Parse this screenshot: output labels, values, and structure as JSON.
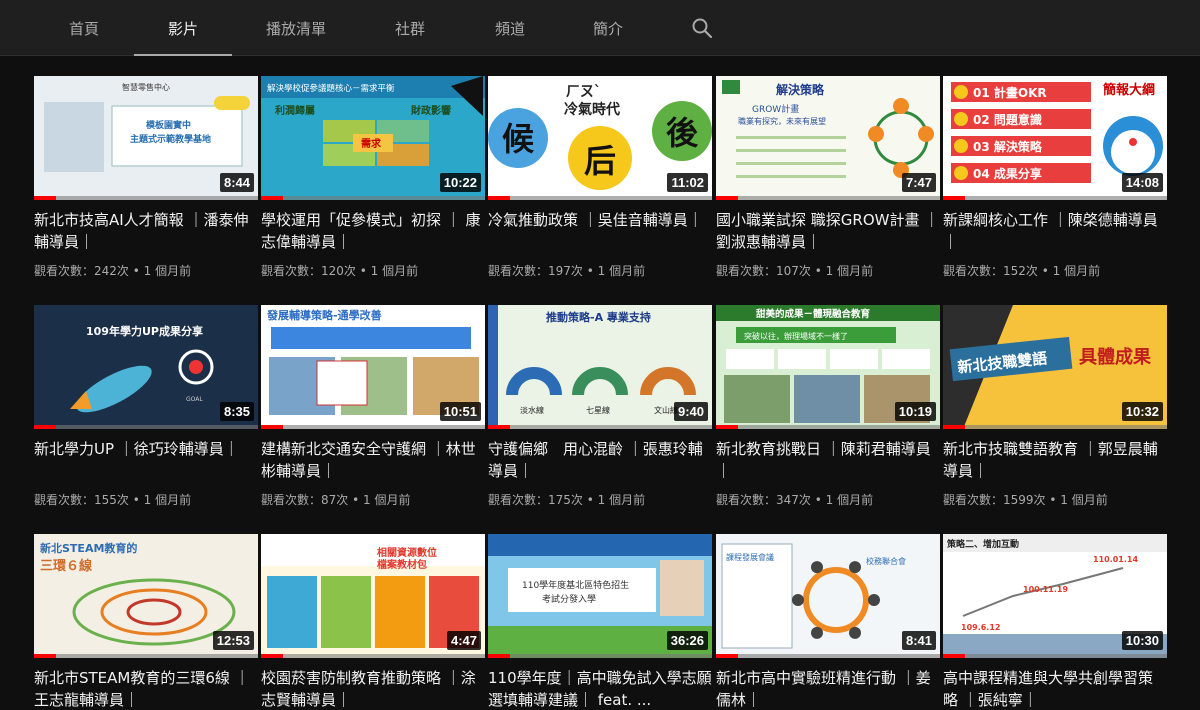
{
  "nav": {
    "tabs": [
      {
        "label": "首頁",
        "active": false
      },
      {
        "label": "影片",
        "active": true
      },
      {
        "label": "播放清單",
        "active": false
      },
      {
        "label": "社群",
        "active": false
      },
      {
        "label": "頻道",
        "active": false
      },
      {
        "label": "簡介",
        "active": false
      }
    ],
    "search_icon": "search-icon"
  },
  "videos": [
    {
      "title": "新北市技高AI人才簡報 ｜潘泰伸輔導員｜",
      "views": "觀看次數：242次",
      "age": "1 個月前",
      "duration": "8:44",
      "progress": 0.1,
      "thumb": {
        "bg": "#e9eef2",
        "text": [
          "智慧零售中心",
          "模板園實中",
          "主題式示範教學基地"
        ],
        "accent": "#2a6fb0"
      }
    },
    {
      "title": "學校運用「促參模式」初探 ｜ 康志偉輔導員｜",
      "views": "觀看次數：120次",
      "age": "1 個月前",
      "duration": "10:22",
      "progress": 0.1,
      "thumb": {
        "bg": "#2aa7c9",
        "text": [
          "解決學校促參議題核心－需求平衡",
          "利潤歸屬",
          "財政影響",
          "需求"
        ],
        "accent": "#f4c542"
      }
    },
    {
      "title": "冷氣推動政策 ｜吳佳音輔導員｜",
      "views": "觀看次數：197次",
      "age": "1 個月前",
      "duration": "11:02",
      "progress": 0.1,
      "thumb": {
        "bg": "#ffffff",
        "text": [
          "ㄏㄡˋ",
          "冷氣時代",
          "候",
          "后",
          "後"
        ],
        "accent": "#5fb043"
      }
    },
    {
      "title": "國小職業試探 職探GROW計畫 ｜劉淑惠輔導員｜",
      "views": "觀看次數：107次",
      "age": "1 個月前",
      "duration": "7:47",
      "progress": 0.1,
      "thumb": {
        "bg": "#f7f9f0",
        "text": [
          "解決策略",
          "GROW計畫",
          "職業有探究，未來有展望"
        ],
        "accent": "#2f8a3d"
      }
    },
    {
      "title": "新課綱核心工作 ｜陳棨德輔導員｜",
      "views": "觀看次數：152次",
      "age": "1 個月前",
      "duration": "14:08",
      "progress": 0.1,
      "thumb": {
        "bg": "#ffffff",
        "text": [
          "簡報大綱",
          "01 計畫OKR",
          "02 問題意識",
          "03 解決策略",
          "04 成果分享"
        ],
        "accent": "#e83e3e"
      }
    },
    {
      "title": "新北學力UP ｜徐巧玲輔導員｜",
      "views": "觀看次數：155次",
      "age": "1 個月前",
      "duration": "8:35",
      "progress": 0.1,
      "thumb": {
        "bg": "#1c2f48",
        "text": [
          "109年學力UP成果分享",
          "GOAL"
        ],
        "accent": "#3f7fcf"
      }
    },
    {
      "title": "建構新北交通安全守護網 ｜林世彬輔導員｜",
      "views": "觀看次數：87次",
      "age": "1 個月前",
      "duration": "10:51",
      "progress": 0.1,
      "thumb": {
        "bg": "#ffffff",
        "text": [
          "發展輔導策略-通學改善"
        ],
        "accent": "#2b7de0"
      }
    },
    {
      "title": "守護偏鄉　用心混齡 ｜張惠玲輔導員｜",
      "views": "觀看次數：175次",
      "age": "1 個月前",
      "duration": "9:40",
      "progress": 0.1,
      "thumb": {
        "bg": "#eaf3e6",
        "text": [
          "推動策略-A 專業支持",
          "淡水線",
          "七星線",
          "文山線"
        ],
        "accent": "#2f63b4"
      }
    },
    {
      "title": "新北教育挑戰日 ｜陳莉君輔導員｜",
      "views": "觀看次數：347次",
      "age": "1 個月前",
      "duration": "10:19",
      "progress": 0.1,
      "thumb": {
        "bg": "#d9efd4",
        "text": [
          "甜美的成果－體現融合教育",
          "突破以往，辦理場域不一樣了"
        ],
        "accent": "#d04a8a"
      }
    },
    {
      "title": "新北市技職雙語教育 ｜郭昱晨輔導員｜",
      "views": "觀看次數：1599次",
      "age": "1 個月前",
      "duration": "10:32",
      "progress": 0.1,
      "thumb": {
        "bg": "#f6c23c",
        "text": [
          "新北技職雙語",
          "具體成果"
        ],
        "accent": "#c21d1d"
      }
    },
    {
      "title": "新北市STEAM教育的三環6線 ｜王志龍輔導員｜",
      "views": "",
      "age": "",
      "duration": "12:53",
      "progress": 0.1,
      "thumb": {
        "bg": "#f4efe4",
        "text": [
          "新北STEAM教育的",
          "三環６線"
        ],
        "accent": "#d06b2a"
      }
    },
    {
      "title": "校園菸害防制教育推動策略 ｜涂志賢輔導員｜",
      "views": "",
      "age": "",
      "duration": "4:47",
      "progress": 0.1,
      "thumb": {
        "bg": "#fff7e0",
        "text": [
          "相關資源數位",
          "檔案教材包"
        ],
        "accent": "#e0392b"
      }
    },
    {
      "title": "110學年度｜高中職免試入學志願選填輔導建議｜ feat. ...",
      "views": "",
      "age": "",
      "duration": "36:26",
      "progress": 0.1,
      "thumb": {
        "bg": "#7fc6e8",
        "text": [
          "110學年度基北區特色招生",
          "考試分發入學"
        ],
        "accent": "#2467b0"
      }
    },
    {
      "title": "新北市高中實驗班精進行動 ｜姜儒林｜",
      "views": "",
      "age": "",
      "duration": "8:41",
      "progress": 0.1,
      "thumb": {
        "bg": "#f2f6f8",
        "text": [
          "課程發展會議",
          "校務聯合會"
        ],
        "accent": "#f08a24"
      }
    },
    {
      "title": "高中課程精進與大學共創學習策略 ｜張純寧｜",
      "views": "",
      "age": "",
      "duration": "10:30",
      "progress": 0.1,
      "thumb": {
        "bg": "#ffffff",
        "text": [
          "策略二、增加互動",
          "109.6.12",
          "100.11.19",
          "110.01.14"
        ],
        "accent": "#e0392b"
      }
    }
  ]
}
